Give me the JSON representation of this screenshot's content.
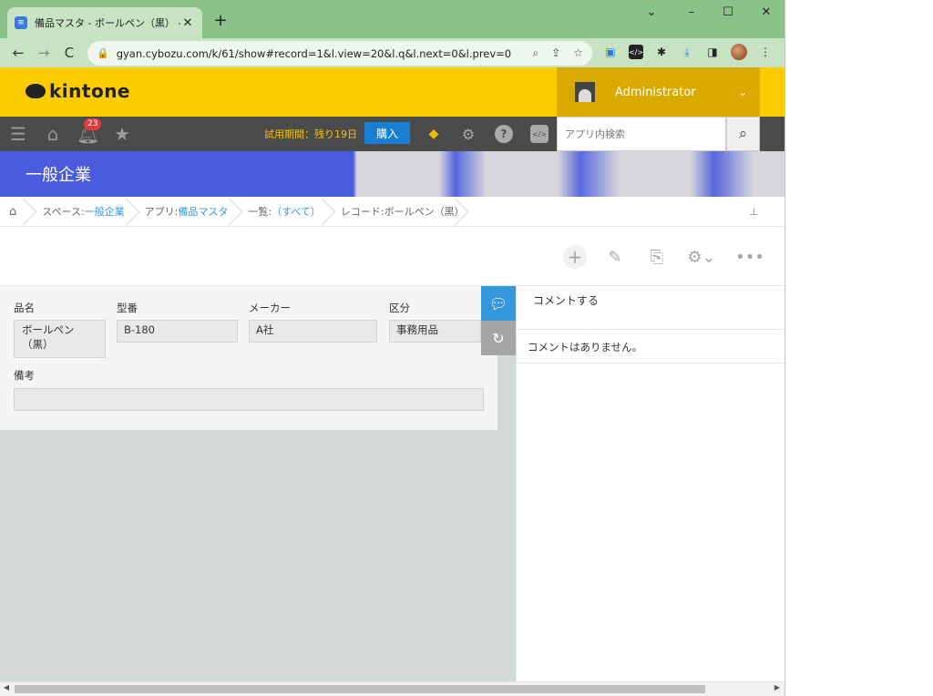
{
  "browser": {
    "tab_title": "備品マスタ - ボールペン（黒） - レコ",
    "tab_close": "✕",
    "new_tab": "+",
    "url": "gyan.cybozu.com/k/61/show#record=1&l.view=20&l.q&l.next=0&l.prev=0",
    "win_controls": [
      "⌄",
      "–",
      "☐",
      "✕"
    ]
  },
  "kintone": {
    "logo": "kintone",
    "user_name": "Administrator",
    "notification_count": "23",
    "trial_text": "試用期間：残り19日",
    "buy_label": "購入",
    "search_placeholder": "アプリ内検索"
  },
  "space": {
    "title": "一般企業"
  },
  "breadcrumb": {
    "space_prefix": "スペース: ",
    "space_name": "一般企業",
    "app_prefix": "アプリ: ",
    "app_name": "備品マスタ",
    "list_prefix": "一覧: ",
    "list_name": "（すべて）",
    "record_prefix": "レコード: ",
    "record_name": "ボールペン（黒）"
  },
  "record": {
    "fields": [
      {
        "label": "品名",
        "value": "ボールペン\n（黒）"
      },
      {
        "label": "型番",
        "value": "B-180"
      },
      {
        "label": "メーカー",
        "value": "A社"
      },
      {
        "label": "区分",
        "value": "事務用品"
      },
      {
        "label": "備考",
        "value": ""
      }
    ]
  },
  "comments": {
    "input_placeholder": "コメントする",
    "empty_text": "コメントはありません。"
  }
}
